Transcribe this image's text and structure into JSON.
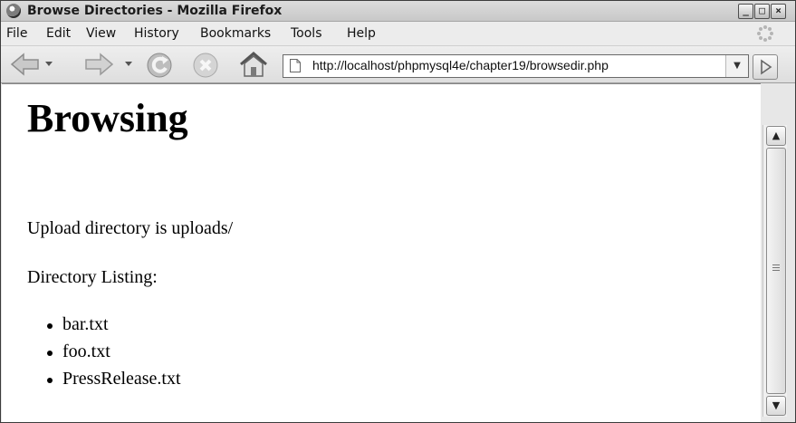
{
  "window": {
    "title": "Browse Directories - Mozilla Firefox"
  },
  "menu": [
    {
      "label": "File"
    },
    {
      "label": "Edit"
    },
    {
      "label": "View"
    },
    {
      "label": "History"
    },
    {
      "label": "Bookmarks"
    },
    {
      "label": "Tools"
    },
    {
      "label": "Help"
    }
  ],
  "toolbar": {
    "back_icon": "back-arrow-icon",
    "forward_icon": "forward-arrow-icon",
    "reload_icon": "reload-icon",
    "stop_icon": "stop-icon",
    "home_icon": "home-icon",
    "url": "http://localhost/phpmysql4e/chapter19/browsedir.php"
  },
  "page": {
    "heading": "Browsing",
    "upload_line": "Upload directory is uploads/",
    "listing_label": "Directory Listing:",
    "files": [
      "bar.txt",
      "foo.txt",
      "PressRelease.txt"
    ]
  },
  "colors": {
    "chrome": "#e7e7e7",
    "content_bg": "#ffffff",
    "text": "#000000"
  }
}
